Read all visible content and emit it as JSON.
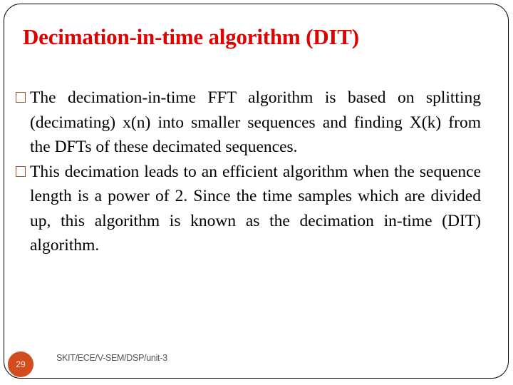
{
  "slide": {
    "title": "Decimation-in-time algorithm (DIT)",
    "bullets": [
      {
        "text": "The decimation-in-time FFT algorithm is based on splitting (decimating) x(n) into smaller sequences and finding X(k) from the DFTs of these decimated sequences."
      },
      {
        "text": "This decimation leads to an efficient algorithm when the sequence length is a power of 2. Since the time samples which are divided up, this algorithm is known as the decimation in-time (DIT) algorithm."
      }
    ],
    "slide_number": "29",
    "footer": "SKIT/ECE/V-SEM/DSP/unit-3"
  },
  "colors": {
    "title": "#e00000",
    "bullet_box": "#a0522d",
    "slide_number_bg": "#d24d1e"
  }
}
